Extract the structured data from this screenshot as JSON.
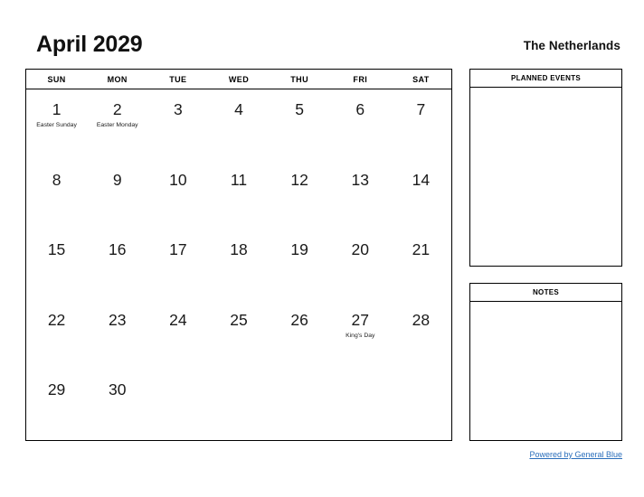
{
  "header": {
    "title": "April 2029",
    "region": "The Netherlands"
  },
  "calendar": {
    "weekdays": [
      "SUN",
      "MON",
      "TUE",
      "WED",
      "THU",
      "FRI",
      "SAT"
    ],
    "weeks": [
      [
        {
          "day": "1",
          "event": "Easter Sunday"
        },
        {
          "day": "2",
          "event": "Easter Monday"
        },
        {
          "day": "3",
          "event": ""
        },
        {
          "day": "4",
          "event": ""
        },
        {
          "day": "5",
          "event": ""
        },
        {
          "day": "6",
          "event": ""
        },
        {
          "day": "7",
          "event": ""
        }
      ],
      [
        {
          "day": "8",
          "event": ""
        },
        {
          "day": "9",
          "event": ""
        },
        {
          "day": "10",
          "event": ""
        },
        {
          "day": "11",
          "event": ""
        },
        {
          "day": "12",
          "event": ""
        },
        {
          "day": "13",
          "event": ""
        },
        {
          "day": "14",
          "event": ""
        }
      ],
      [
        {
          "day": "15",
          "event": ""
        },
        {
          "day": "16",
          "event": ""
        },
        {
          "day": "17",
          "event": ""
        },
        {
          "day": "18",
          "event": ""
        },
        {
          "day": "19",
          "event": ""
        },
        {
          "day": "20",
          "event": ""
        },
        {
          "day": "21",
          "event": ""
        }
      ],
      [
        {
          "day": "22",
          "event": ""
        },
        {
          "day": "23",
          "event": ""
        },
        {
          "day": "24",
          "event": ""
        },
        {
          "day": "25",
          "event": ""
        },
        {
          "day": "26",
          "event": ""
        },
        {
          "day": "27",
          "event": "King's Day"
        },
        {
          "day": "28",
          "event": ""
        }
      ],
      [
        {
          "day": "29",
          "event": ""
        },
        {
          "day": "30",
          "event": ""
        },
        {
          "day": "",
          "event": ""
        },
        {
          "day": "",
          "event": ""
        },
        {
          "day": "",
          "event": ""
        },
        {
          "day": "",
          "event": ""
        },
        {
          "day": "",
          "event": ""
        }
      ]
    ]
  },
  "panels": {
    "planned_events": {
      "title": "PLANNED EVENTS",
      "content": ""
    },
    "notes": {
      "title": "NOTES",
      "content": ""
    }
  },
  "footer": {
    "link_label": "Powered by General Blue"
  },
  "colors": {
    "link": "#2a6ebb",
    "border": "#000000",
    "text": "#111111",
    "background": "#ffffff"
  }
}
